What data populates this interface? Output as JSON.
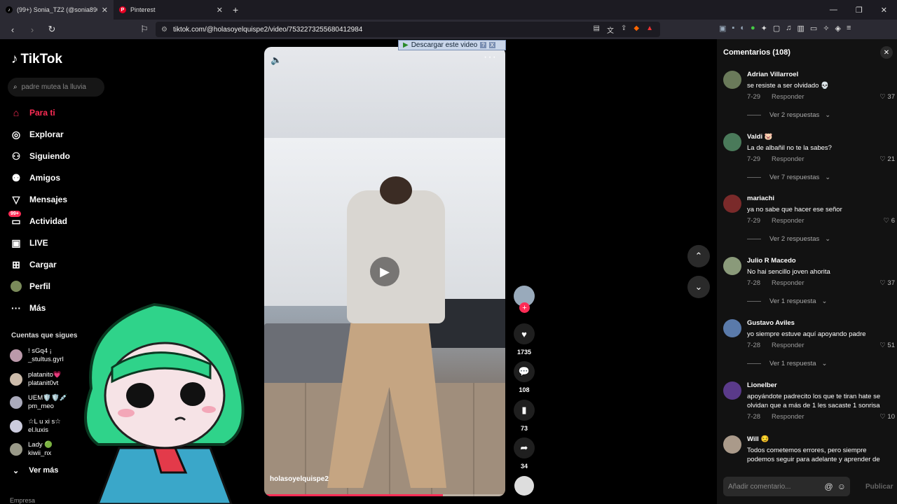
{
  "browser": {
    "tabs": [
      {
        "title": "(99+) Sonia_TZ2 (@sonia890...",
        "active": true,
        "icon": "tiktok-icon"
      },
      {
        "title": "Pinterest",
        "active": false,
        "icon": "pinterest-icon"
      }
    ],
    "url": "tiktok.com/@holasoyelquispe2/video/7532273255680412984"
  },
  "sidebar": {
    "logo": "TikTok",
    "search_placeholder": "padre mutea la lluvia",
    "nav": [
      {
        "label": "Para ti",
        "icon": "home-icon"
      },
      {
        "label": "Explorar",
        "icon": "compass-icon"
      },
      {
        "label": "Siguiendo",
        "icon": "following-icon"
      },
      {
        "label": "Amigos",
        "icon": "friends-icon"
      },
      {
        "label": "Mensajes",
        "icon": "messages-icon"
      },
      {
        "label": "Actividad",
        "icon": "activity-icon",
        "badge": "99+"
      },
      {
        "label": "LIVE",
        "icon": "live-icon"
      },
      {
        "label": "Cargar",
        "icon": "upload-icon"
      },
      {
        "label": "Perfil",
        "icon": "profile-icon"
      },
      {
        "label": "Más",
        "icon": "more-icon"
      }
    ],
    "following_title": "Cuentas que sigues",
    "accounts": [
      {
        "name": "! sGq4 ¡",
        "handle": "_stultus.gyrl"
      },
      {
        "name": "platanito💗",
        "handle": "platanit0vt"
      },
      {
        "name": "UEM🛡️🛡️💉",
        "handle": "pm_meo"
      },
      {
        "name": "☆L u xi s☆",
        "handle": "el.luxis"
      },
      {
        "name": "Lady 🟢",
        "handle": "kiwii_nx"
      }
    ],
    "see_more": "Ver más",
    "footer": "Empresa"
  },
  "video": {
    "author": "holasoyelquispe2",
    "download_label": "Descargar este video",
    "progress": 0.74
  },
  "actions": {
    "likes": "1735",
    "comments": "108",
    "saves": "73",
    "shares": "34"
  },
  "comments": {
    "title": "Comentarios (108)",
    "items": [
      {
        "user": "Adrian Villarroel",
        "text": "se resiste a ser olvidado 💀",
        "date": "7-29",
        "reply": "Responder",
        "likes": "37",
        "more": "Ver 2 respuestas"
      },
      {
        "user": "Valdi 🐷",
        "text": "La de albañil no te la sabes?",
        "date": "7-29",
        "reply": "Responder",
        "likes": "21",
        "more": "Ver 7 respuestas"
      },
      {
        "user": "mariachi",
        "text": "ya no sabe que hacer ese señor",
        "date": "7-29",
        "reply": "Responder",
        "likes": "6",
        "more": "Ver 2 respuestas"
      },
      {
        "user": "Julio R Macedo",
        "text": "No hai sencillo joven ahorita",
        "date": "7-28",
        "reply": "Responder",
        "likes": "37",
        "more": "Ver 1 respuesta"
      },
      {
        "user": "Gustavo Aviles",
        "text": "yo siempre estuve aquí apoyando padre",
        "date": "7-28",
        "reply": "Responder",
        "likes": "51",
        "more": "Ver 1 respuesta"
      },
      {
        "user": "Lionelber",
        "text": "apoyándote padrecito los que te tiran hate se olvidan que a más de 1 les sacaste 1 sonrisa",
        "date": "7-28",
        "reply": "Responder",
        "likes": "10",
        "more": ""
      },
      {
        "user": "Will 😏",
        "text": "Todos cometemos errores, pero siempre podemos seguir para adelante y aprender de",
        "date": "",
        "reply": "",
        "likes": "",
        "more": ""
      }
    ],
    "add_placeholder": "Añadir comentario...",
    "publish": "Publicar"
  },
  "colors": {
    "accent": "#fe2c55",
    "panel": "#121212"
  }
}
